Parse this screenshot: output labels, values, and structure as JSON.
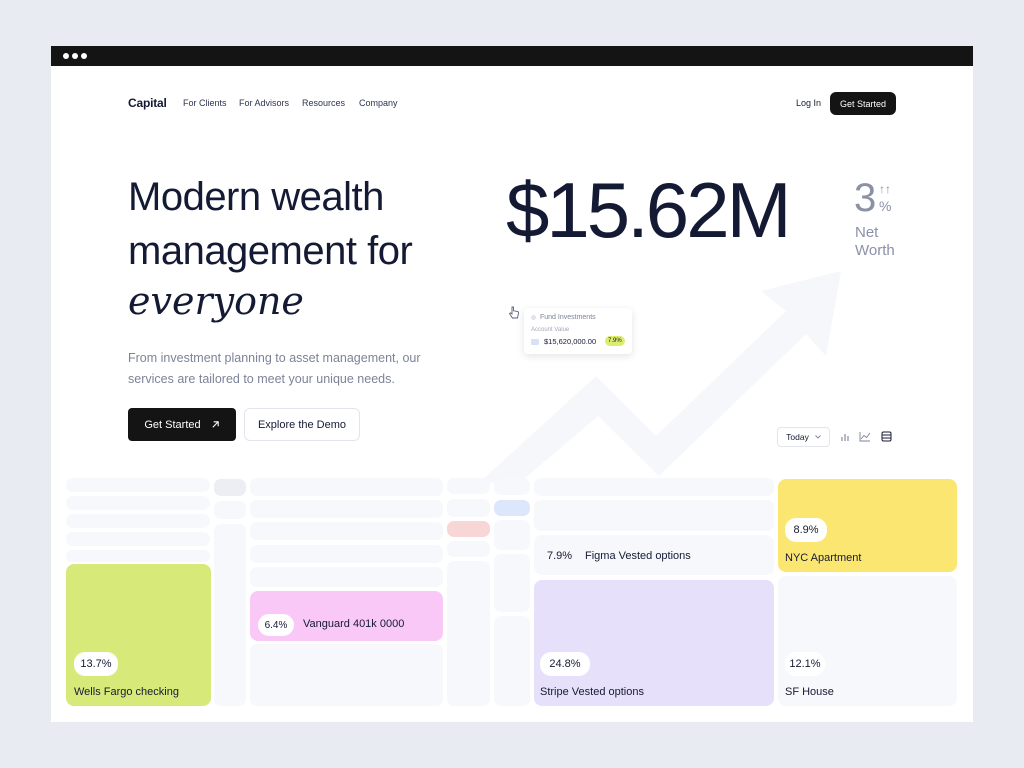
{
  "nav": {
    "logo": "Capital",
    "links": [
      "For Clients",
      "For Advisors",
      "Resources",
      "Company"
    ],
    "login": "Log In",
    "cta": "Get Started"
  },
  "hero": {
    "headline": "Modern wealth management for",
    "headline_italic": "everyone",
    "subtext": "From investment planning to asset management, our services are tailored to meet your unique needs.",
    "primary_cta": "Get Started",
    "secondary_cta": "Explore the Demo"
  },
  "networth": {
    "value": "$15.62M",
    "change_number": "3",
    "change_arrow": "↑↑",
    "change_unit": "%",
    "label": "Net Worth"
  },
  "fund_card": {
    "title": "Fund Investments",
    "label": "Account Value",
    "value": "$15,620,000.00",
    "badge": "7.9%"
  },
  "controls": {
    "period": "Today",
    "icons": [
      "bar-chart-icon",
      "line-chart-icon",
      "table-icon"
    ]
  },
  "holdings": {
    "wells_fargo": {
      "pct": "13.7%",
      "name": "Wells Fargo checking",
      "color": "#d7ea79"
    },
    "vanguard": {
      "pct": "6.4%",
      "name": "Vanguard 401k 0000",
      "color": "#fac8f6"
    },
    "figma": {
      "pct": "7.9%",
      "name": "Figma Vested options"
    },
    "stripe": {
      "pct": "24.8%",
      "name": "Stripe Vested options",
      "color": "#e6e0fb"
    },
    "nyc": {
      "pct": "8.9%",
      "name": "NYC Apartment",
      "color": "#fbe672"
    },
    "sf_house": {
      "pct": "12.1%",
      "name": "SF House"
    }
  }
}
